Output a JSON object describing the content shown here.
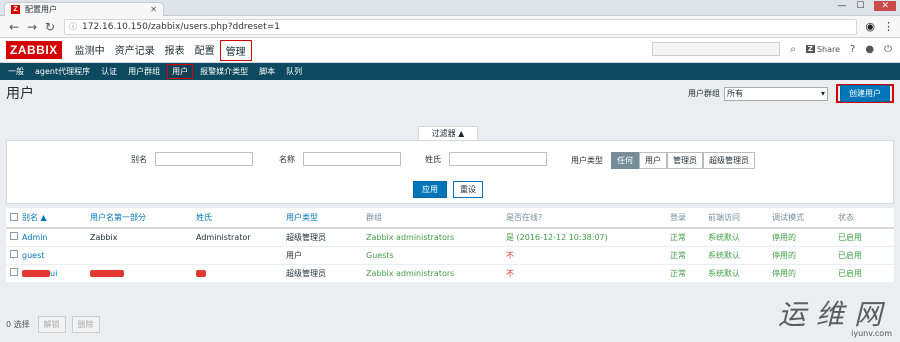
{
  "browser": {
    "tab_title": "配置用户",
    "tab_favicon": "Z",
    "url_info": "ⓘ",
    "url": "172.16.10.150/zabbix/users.php?ddreset=1"
  },
  "header": {
    "logo": "ZABBIX",
    "menu": [
      {
        "label": "监测中",
        "active": false
      },
      {
        "label": "资产记录",
        "active": false
      },
      {
        "label": "报表",
        "active": false
      },
      {
        "label": "配置",
        "active": false
      },
      {
        "label": "管理",
        "active": true
      }
    ],
    "share_icon": "Z",
    "share_label": "Share"
  },
  "submenu": [
    {
      "label": "一般",
      "active": false
    },
    {
      "label": "agent代理程序",
      "active": false
    },
    {
      "label": "认证",
      "active": false
    },
    {
      "label": "用户群组",
      "active": false
    },
    {
      "label": "用户",
      "active": true
    },
    {
      "label": "报警媒介类型",
      "active": false
    },
    {
      "label": "脚本",
      "active": false
    },
    {
      "label": "队列",
      "active": false
    }
  ],
  "page": {
    "title": "用户",
    "group_label": "用户群组",
    "group_value": "所有",
    "create_button": "创建用户"
  },
  "filter": {
    "tab_label": "过滤器 ▲",
    "alias_label": "别名",
    "name_label": "名称",
    "surname_label": "姓氏",
    "type_label": "用户类型",
    "type_options": [
      {
        "label": "任何",
        "on": true
      },
      {
        "label": "用户",
        "on": false
      },
      {
        "label": "管理员",
        "on": false
      },
      {
        "label": "超级管理员",
        "on": false
      }
    ],
    "apply": "应用",
    "reset": "重设"
  },
  "table": {
    "columns": {
      "alias": "别名 ▲",
      "name": "用户名第一部分",
      "surname": "姓氏",
      "type": "用户类型",
      "groups": "群组",
      "online": "是否在线?",
      "login": "登录",
      "frontend": "前端访问",
      "debug": "调试模式",
      "status": "状态"
    },
    "rows": [
      {
        "alias": "Admin",
        "name": "Zabbix",
        "surname": "Administrator",
        "type": "超级管理员",
        "groups": "Zabbix administrators",
        "online": "是 (2016-12-12 10:38:07)",
        "login": "正常",
        "frontend": "系统默认",
        "debug": "停用的",
        "status": "已启用"
      },
      {
        "alias": "guest",
        "name": "",
        "surname": "",
        "type": "用户",
        "groups": "Guests",
        "online": "不",
        "login": "正常",
        "frontend": "系统默认",
        "debug": "停用的",
        "status": "已启用"
      },
      {
        "alias": "ui",
        "name": "",
        "surname": "",
        "type": "超级管理员",
        "groups": "Zabbix administrators",
        "online": "不",
        "login": "正常",
        "frontend": "系统默认",
        "debug": "停用的",
        "status": "已启用"
      }
    ]
  },
  "footer": {
    "selected": "0 选择",
    "unlock": "解锁",
    "delete": "删除"
  },
  "watermark": {
    "big": "运维网",
    "small": "iyunv.com"
  }
}
